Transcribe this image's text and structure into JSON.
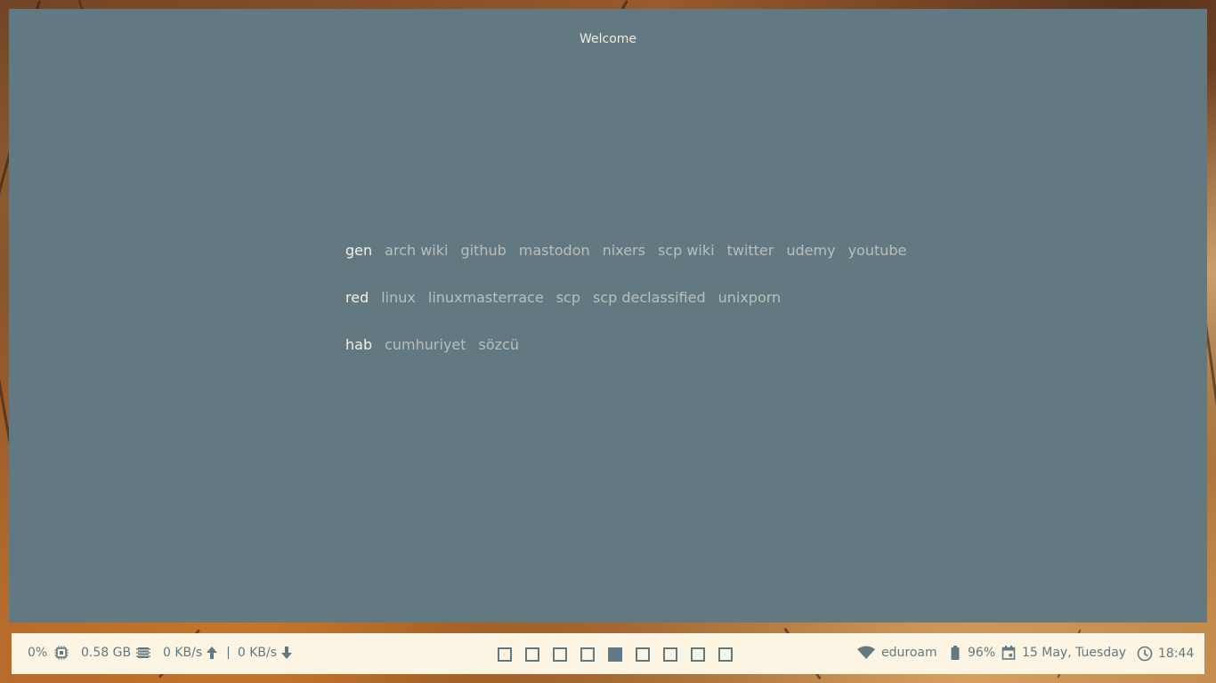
{
  "window": {
    "title": "Welcome"
  },
  "links": [
    {
      "category": "gen",
      "items": [
        "arch wiki",
        "github",
        "mastodon",
        "nixers",
        "scp wiki",
        "twitter",
        "udemy",
        "youtube"
      ]
    },
    {
      "category": "red",
      "items": [
        "linux",
        "linuxmasterrace",
        "scp",
        "scp declassified",
        "unixporn"
      ]
    },
    {
      "category": "hab",
      "items": [
        "cumhuriyet",
        "sözcü"
      ]
    }
  ],
  "statusbar": {
    "cpu": "0%",
    "memory": "0.58 GB",
    "upload": "0 KB/s",
    "separator": "|",
    "download": "0 KB/s",
    "workspaces": {
      "count": 9,
      "active_index": 4
    },
    "wifi": "eduroam",
    "battery": "96%",
    "date": "15 May, Tuesday",
    "time": "18:44"
  },
  "colors": {
    "window_bg": "#637981",
    "bar_bg": "#fcf5e3",
    "accent": "#637981"
  }
}
